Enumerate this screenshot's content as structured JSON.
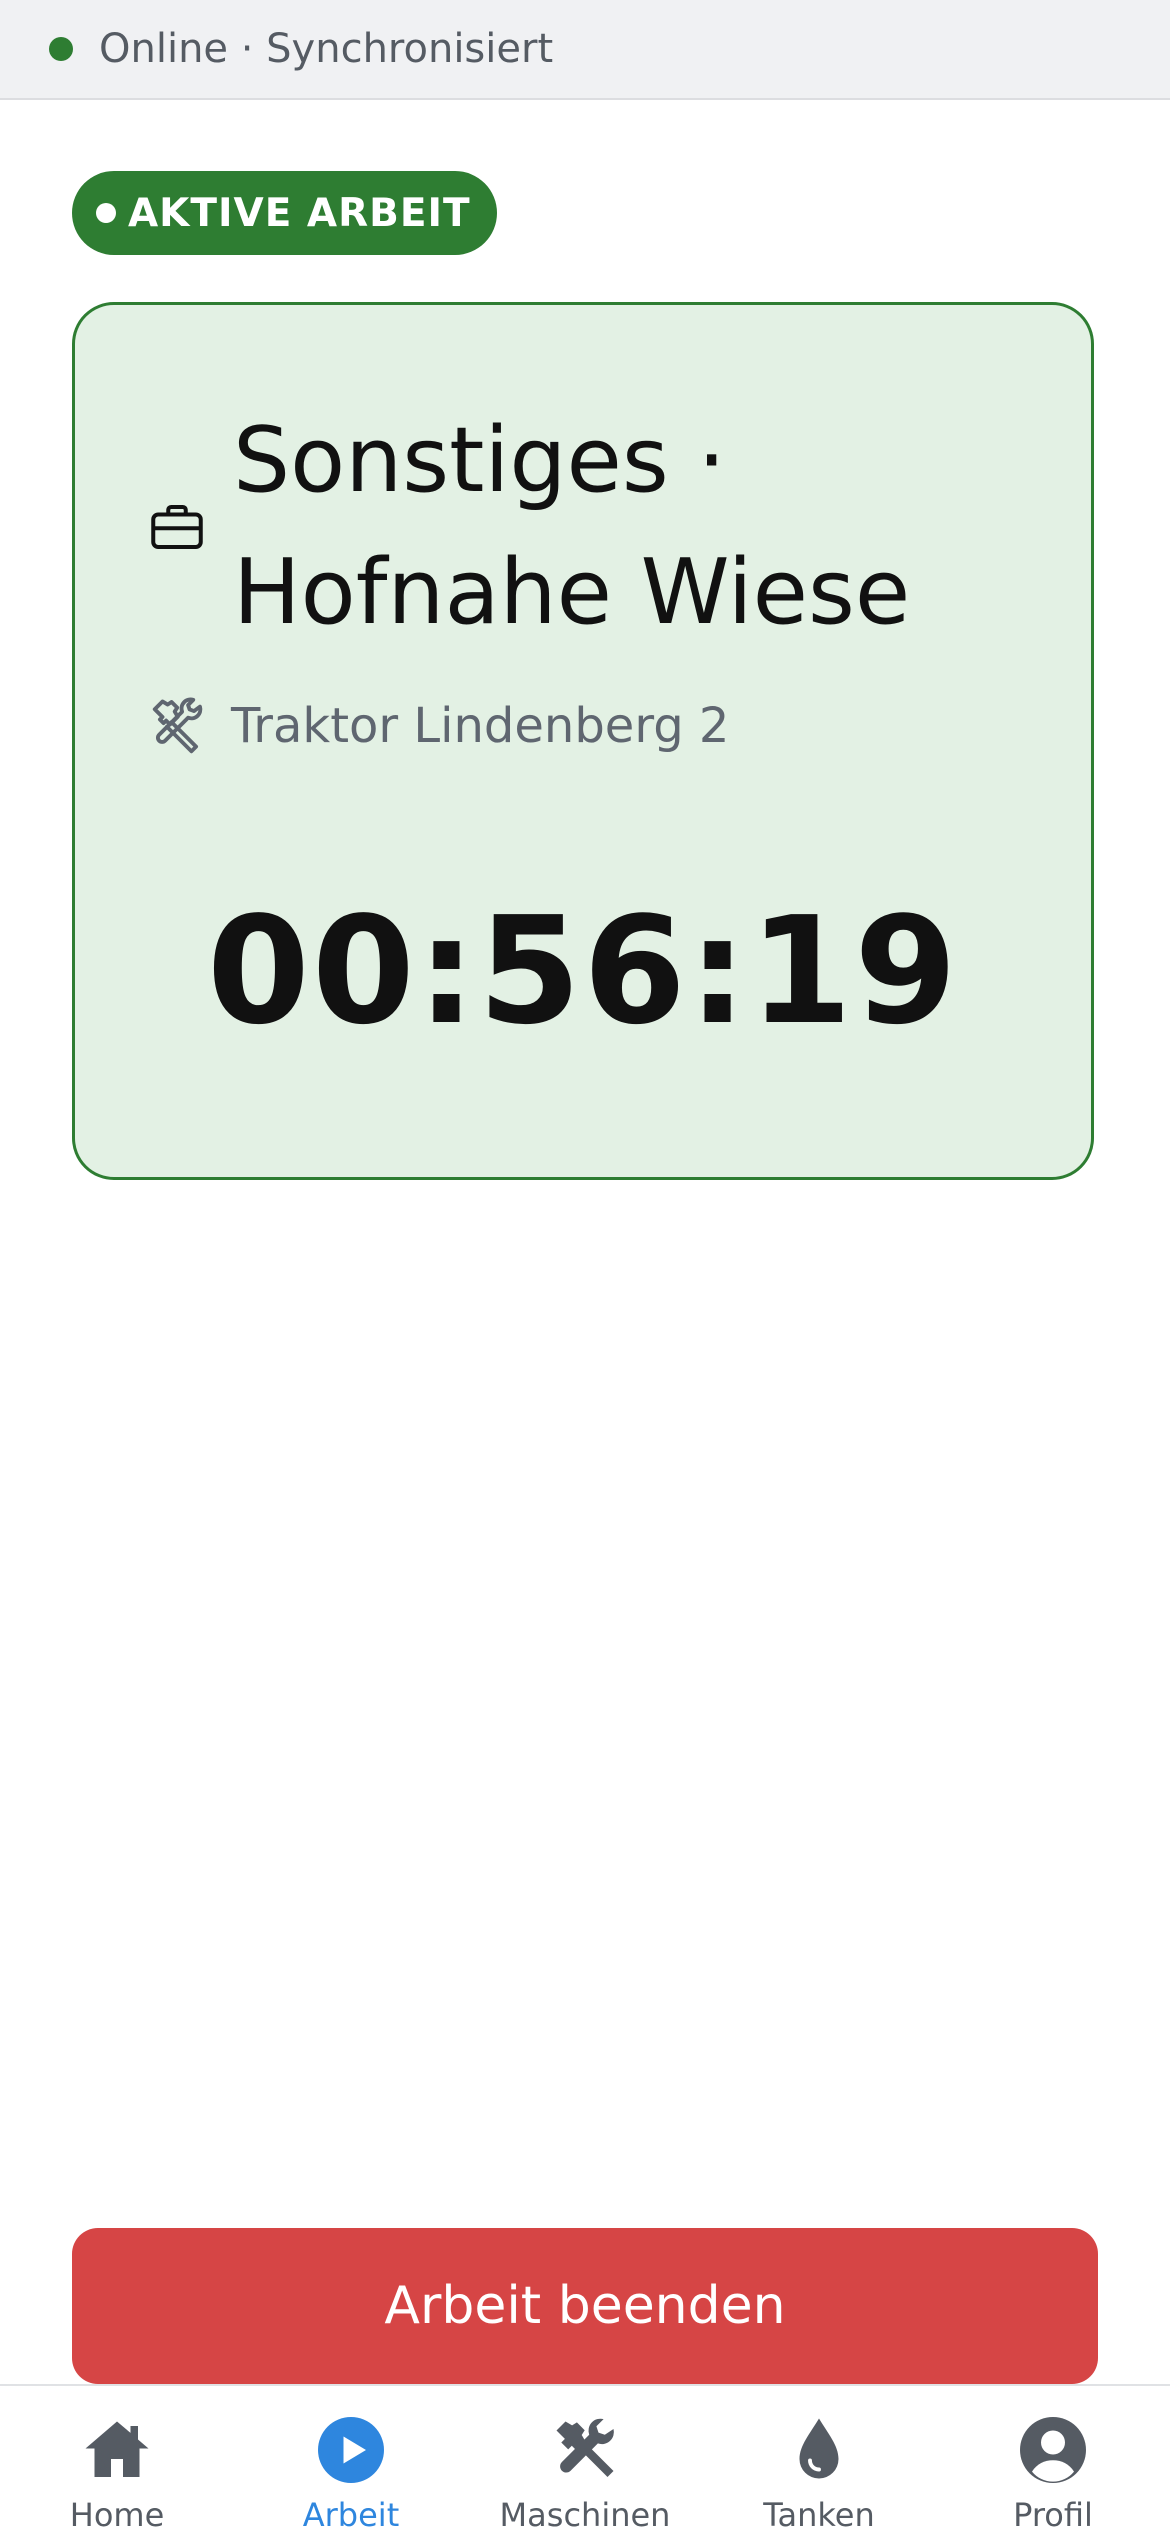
{
  "status": {
    "text": "Online · Synchronisiert",
    "dot_color": "#2e7d32"
  },
  "badge": {
    "label": "AKTIVE ARBEIT",
    "color": "#2e7d32"
  },
  "active_work": {
    "title": "Sonstiges · Hofnahe Wiese",
    "title_icon": "briefcase-icon",
    "machine": "Traktor Lindenberg 2",
    "machine_icon": "tools-icon",
    "timer": "00:56:19",
    "background": "#e3f1e4"
  },
  "end_button": {
    "label": "Arbeit beenden",
    "color": "#d64545"
  },
  "tabs": [
    {
      "label": "Home",
      "icon": "home-icon",
      "active": false
    },
    {
      "label": "Arbeit",
      "icon": "play-icon",
      "active": true
    },
    {
      "label": "Maschinen",
      "icon": "tools-icon",
      "active": false
    },
    {
      "label": "Tanken",
      "icon": "drop-icon",
      "active": false
    },
    {
      "label": "Profil",
      "icon": "user-icon",
      "active": false
    }
  ]
}
